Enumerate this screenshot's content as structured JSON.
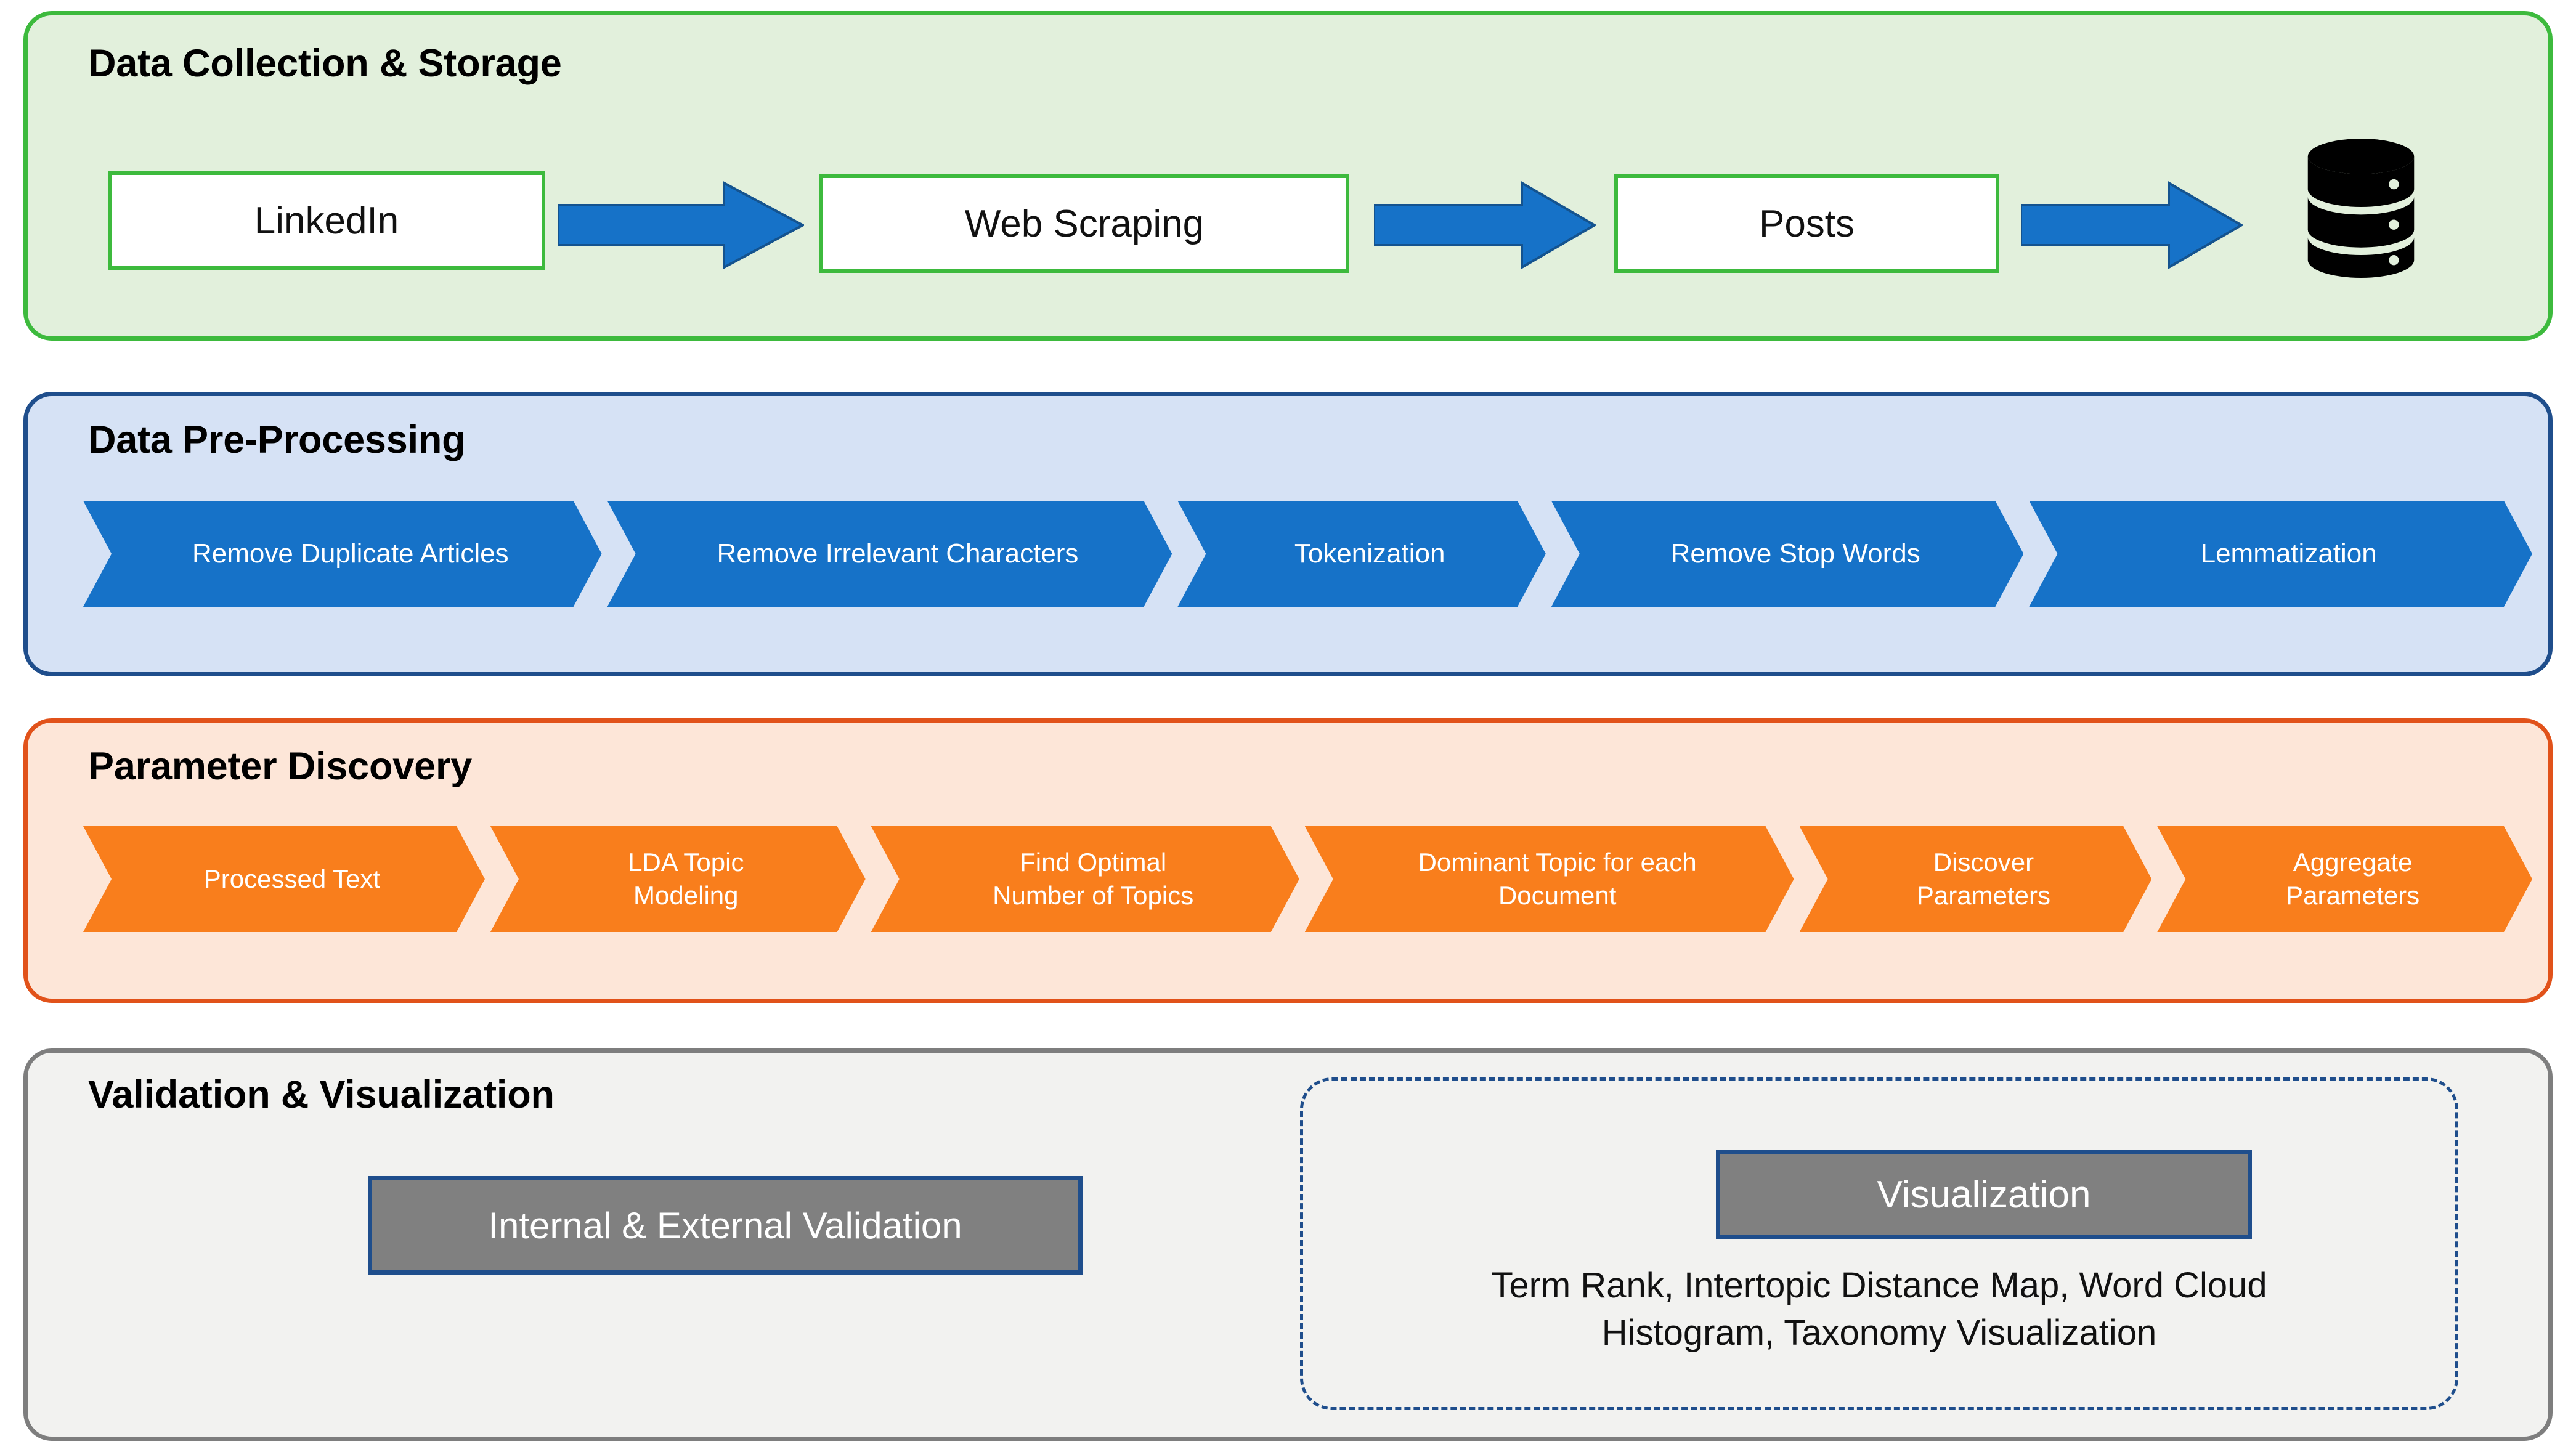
{
  "sections": {
    "collection": {
      "title": "Data Collection & Storage",
      "accent": "#3DBA3D",
      "background": "#E2F0DC",
      "boxes": [
        {
          "label": "LinkedIn"
        },
        {
          "label": "Web Scraping"
        },
        {
          "label": "Posts"
        }
      ],
      "arrows": [
        {
          "icon": "right-block-arrow",
          "color": "#1672C8"
        },
        {
          "icon": "right-block-arrow",
          "color": "#1672C8"
        },
        {
          "icon": "right-block-arrow",
          "color": "#1672C8"
        }
      ],
      "storage_icon": "database-icon"
    },
    "preprocessing": {
      "title": "Data Pre-Processing",
      "accent": "#1F4E8C",
      "background": "#D6E2F5",
      "chevron_color": "#1672C8",
      "steps": [
        {
          "label": "Remove Duplicate Articles"
        },
        {
          "label": "Remove Irrelevant Characters"
        },
        {
          "label": "Tokenization"
        },
        {
          "label": "Remove Stop Words"
        },
        {
          "label": "Lemmatization"
        }
      ]
    },
    "parameter_discovery": {
      "title": "Parameter Discovery",
      "accent": "#E1521A",
      "background": "#FDE6D8",
      "chevron_color": "#F97E1C",
      "steps": [
        {
          "label": "Processed Text"
        },
        {
          "label": "LDA Topic\nModeling"
        },
        {
          "label": "Find Optimal\nNumber of Topics"
        },
        {
          "label": "Dominant Topic for each\nDocument"
        },
        {
          "label": "Discover\nParameters"
        },
        {
          "label": "Aggregate\nParameters"
        }
      ]
    },
    "validation": {
      "title": "Validation & Visualization",
      "accent": "#7E7E7E",
      "background": "#F2F2F0",
      "box_fill": "#808080",
      "box_border": "#1F4E8C",
      "validation_box": "Internal & External Validation",
      "visualization_box": "Visualization",
      "visualization_caption": "Term Rank, Intertopic Distance Map, Word Cloud\nHistogram, Taxonomy Visualization"
    }
  },
  "chart_data": {
    "type": "table",
    "title": "Topic-modeling pipeline flowchart",
    "stages": [
      {
        "stage": "Data Collection & Storage",
        "nodes": [
          "LinkedIn",
          "Web Scraping",
          "Posts",
          "Database"
        ]
      },
      {
        "stage": "Data Pre-Processing",
        "nodes": [
          "Remove Duplicate Articles",
          "Remove Irrelevant Characters",
          "Tokenization",
          "Remove Stop Words",
          "Lemmatization"
        ]
      },
      {
        "stage": "Parameter Discovery",
        "nodes": [
          "Processed Text",
          "LDA Topic Modeling",
          "Find Optimal Number of Topics",
          "Dominant Topic for each Document",
          "Discover Parameters",
          "Aggregate Parameters"
        ]
      },
      {
        "stage": "Validation & Visualization",
        "nodes": [
          "Internal & External Validation",
          "Visualization",
          "Term Rank, Intertopic Distance Map, Word Cloud Histogram, Taxonomy Visualization"
        ]
      }
    ]
  }
}
